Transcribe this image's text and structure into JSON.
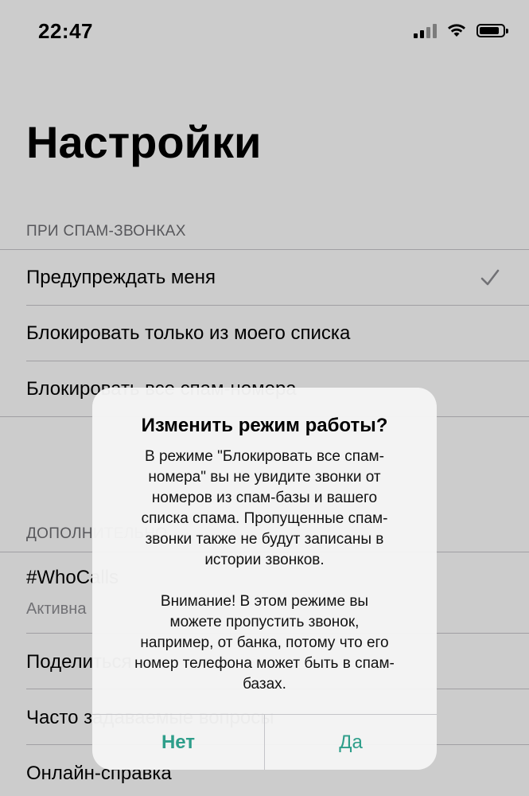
{
  "status_bar": {
    "time": "22:47"
  },
  "settings": {
    "title": "Настройки",
    "spam_section": {
      "header": "ПРИ СПАМ-ЗВОНКАХ",
      "options": [
        {
          "label": "Предупреждать меня",
          "checked": true
        },
        {
          "label": "Блокировать только из моего списка",
          "checked": false
        },
        {
          "label": "Блокировать все спам-номера",
          "checked": false
        }
      ]
    },
    "extra_section": {
      "header": "ДОПОЛНИТЕЛЬНО",
      "items": [
        {
          "label": "#WhoCalls",
          "sublabel": "Активна"
        },
        {
          "label": "Поделиться"
        },
        {
          "label": "Часто задаваемые вопросы"
        },
        {
          "label": "Онлайн-справка"
        }
      ]
    }
  },
  "alert": {
    "title": "Изменить режим работы?",
    "message_lines_1": [
      "В режиме \"Блокировать все спам-",
      "номера\" вы не увидите звонки от",
      "номеров из спам-базы и вашего",
      "списка спама. Пропущенные спам-",
      "звонки также не будут записаны в",
      "истории звонков."
    ],
    "message_lines_2": [
      "Внимание! В этом режиме вы",
      "можете пропустить звонок,",
      "например, от банка, потому что его",
      "номер телефона может быть в спам-",
      "базах."
    ],
    "no_label": "Нет",
    "yes_label": "Да",
    "accent_color": "#2e9e8a"
  }
}
